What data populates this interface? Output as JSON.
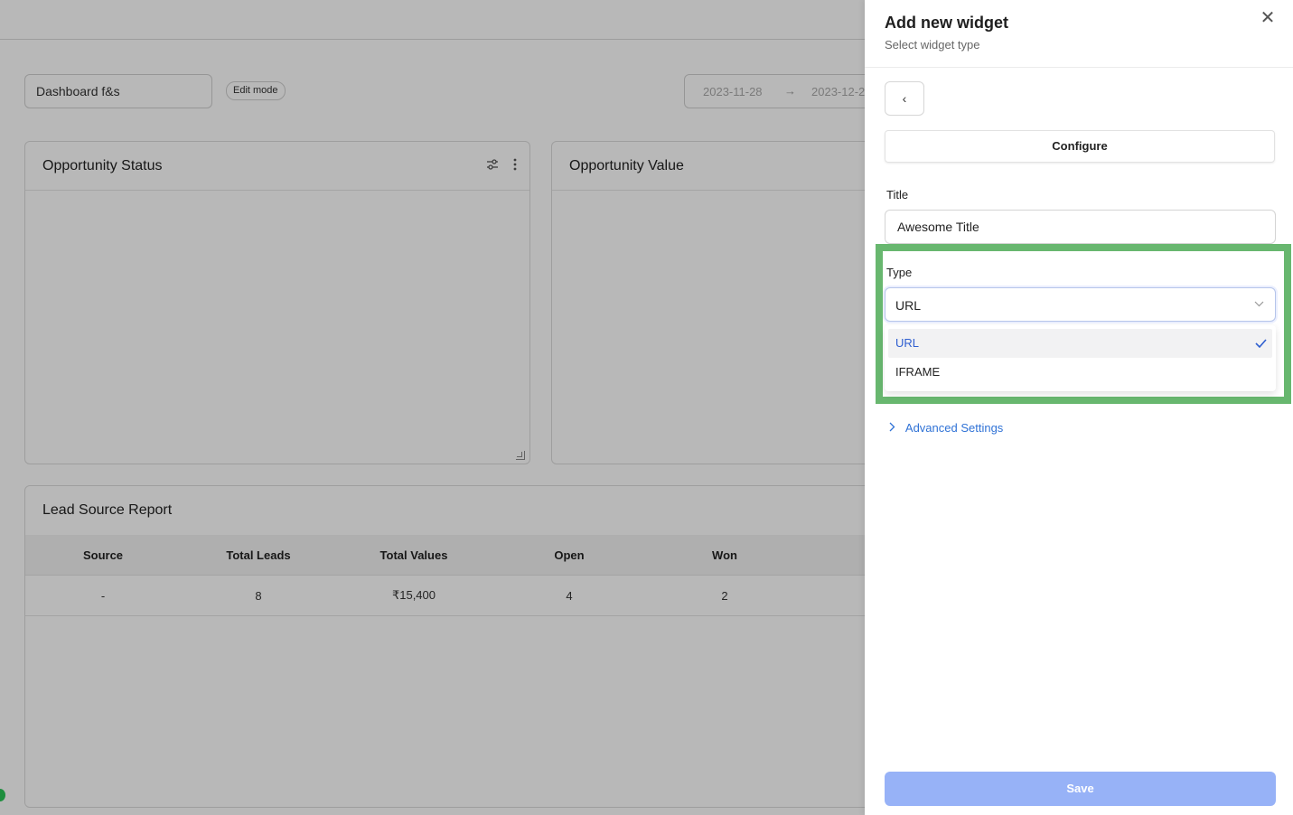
{
  "dashboard": {
    "name": "Dashboard f&s",
    "edit_mode_label": "Edit mode",
    "date_start": "2023-11-28",
    "date_arrow": "→",
    "date_end": "2023-12-2"
  },
  "widgets": {
    "opportunity_status": {
      "title": "Opportunity Status"
    },
    "opportunity_value": {
      "title": "Opportunity Value"
    },
    "lead_source_report": {
      "title": "Lead Source Report",
      "columns": [
        "Source",
        "Total Leads",
        "Total Values",
        "Open",
        "Won"
      ],
      "rows": [
        [
          "-",
          "8",
          "₹15,400",
          "4",
          "2"
        ]
      ]
    }
  },
  "drawer": {
    "title": "Add new widget",
    "subtitle": "Select widget type",
    "back_label": "‹",
    "close_label": "✕",
    "configure_tab": "Configure",
    "title_label": "Title",
    "title_value": "Awesome Title",
    "type_label": "Type",
    "type_value": "URL",
    "type_options": [
      {
        "label": "URL",
        "selected": true
      },
      {
        "label": "IFRAME",
        "selected": false
      }
    ],
    "advanced_label": "Advanced Settings",
    "save_label": "Save"
  },
  "colors": {
    "highlight": "#68b76f",
    "save_button": "#97b2f7",
    "link": "#2f72d6"
  }
}
